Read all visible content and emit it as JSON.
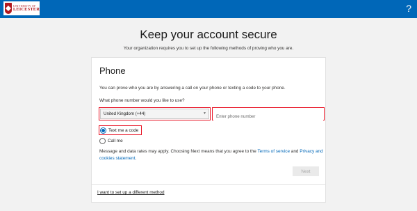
{
  "header": {
    "brand_small": "UNIVERSITY OF",
    "brand_name": "LEICESTER",
    "help": "?"
  },
  "page": {
    "title": "Keep your account secure",
    "subtitle": "Your organization requires you to set up the following methods of proving who you are."
  },
  "card": {
    "title": "Phone",
    "description": "You can prove who you are by answering a call on your phone or texting a code to your phone.",
    "question": "What phone number would you like to use?",
    "country_value": "United Kingdom (+44)",
    "phone_placeholder": "Enter phone number",
    "option_text": "Text me a code",
    "option_call": "Call me",
    "terms_prefix": "Message and data rates may apply. Choosing Next means that you agree to the ",
    "terms_link": "Terms of service",
    "terms_and": " and ",
    "privacy_link": "Privacy and cookies statement",
    "terms_suffix": ".",
    "next_label": "Next",
    "different_method": "I want to set up a different method"
  },
  "colors": {
    "accent": "#0067b8",
    "highlight": "#e81123",
    "brand": "#b3191f"
  }
}
